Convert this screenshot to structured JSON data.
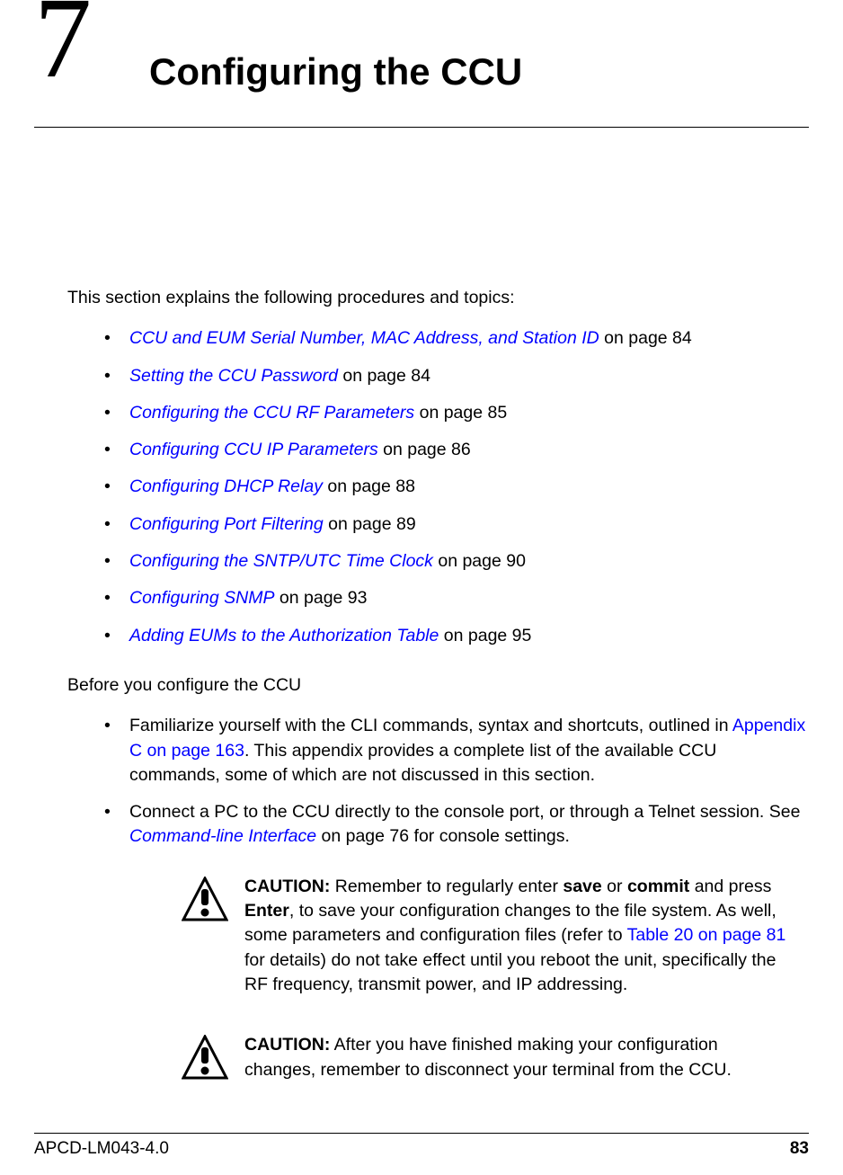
{
  "chapter": {
    "number": "7",
    "title": "Configuring the CCU"
  },
  "intro": "This section explains the following procedures and topics:",
  "topics": [
    {
      "link": "CCU and EUM Serial Number, MAC Address, and Station ID",
      "suffix": " on page 84"
    },
    {
      "link": "Setting the CCU Password",
      "suffix": " on page 84"
    },
    {
      "link": "Configuring the CCU RF Parameters",
      "suffix": " on page 85"
    },
    {
      "link": "Configuring CCU IP Parameters",
      "suffix": " on page 86"
    },
    {
      "link": "Configuring DHCP Relay",
      "suffix": " on page 88"
    },
    {
      "link": "Configuring Port Filtering",
      "suffix": " on page 89"
    },
    {
      "link": "Configuring the SNTP/UTC Time Clock",
      "suffix": " on page 90"
    },
    {
      "link": "Configuring SNMP",
      "suffix": " on page 93"
    },
    {
      "link": "Adding EUMs to the Authorization Table",
      "suffix": " on page 95"
    }
  ],
  "before_heading": "Before you configure the CCU",
  "before_items": [
    {
      "pre": "Familiarize yourself with the CLI commands, syntax and shortcuts, outlined in ",
      "link": "Appendix C on page 163",
      "post": ". This appendix provides a complete list of the available CCU commands, some of which are not discussed in this section."
    },
    {
      "pre": "Connect a PC to the CCU directly to the console port, or through a Telnet session. See ",
      "link": "Command-line Interface",
      "link_italic": true,
      "post": " on page 76 for console settings."
    }
  ],
  "caution1": {
    "label": "CAUTION:",
    "seg1": "   Remember to regularly enter ",
    "b1": "save",
    "seg2": " or ",
    "b2": "commit",
    "seg3": " and press ",
    "b3": "Enter",
    "seg4": ", to save your configuration changes to the file system. As well, some parameters and configuration files (refer to ",
    "link": "Table 20 on page 81",
    "seg5": " for details) do not take effect until you reboot the unit, specifically the RF frequency, transmit power, and IP addressing."
  },
  "caution2": {
    "label": "CAUTION:",
    "text": "   After you have finished making your configuration changes, remember to disconnect your terminal from the CCU."
  },
  "footer": {
    "left": "APCD-LM043-4.0",
    "right": "83"
  }
}
